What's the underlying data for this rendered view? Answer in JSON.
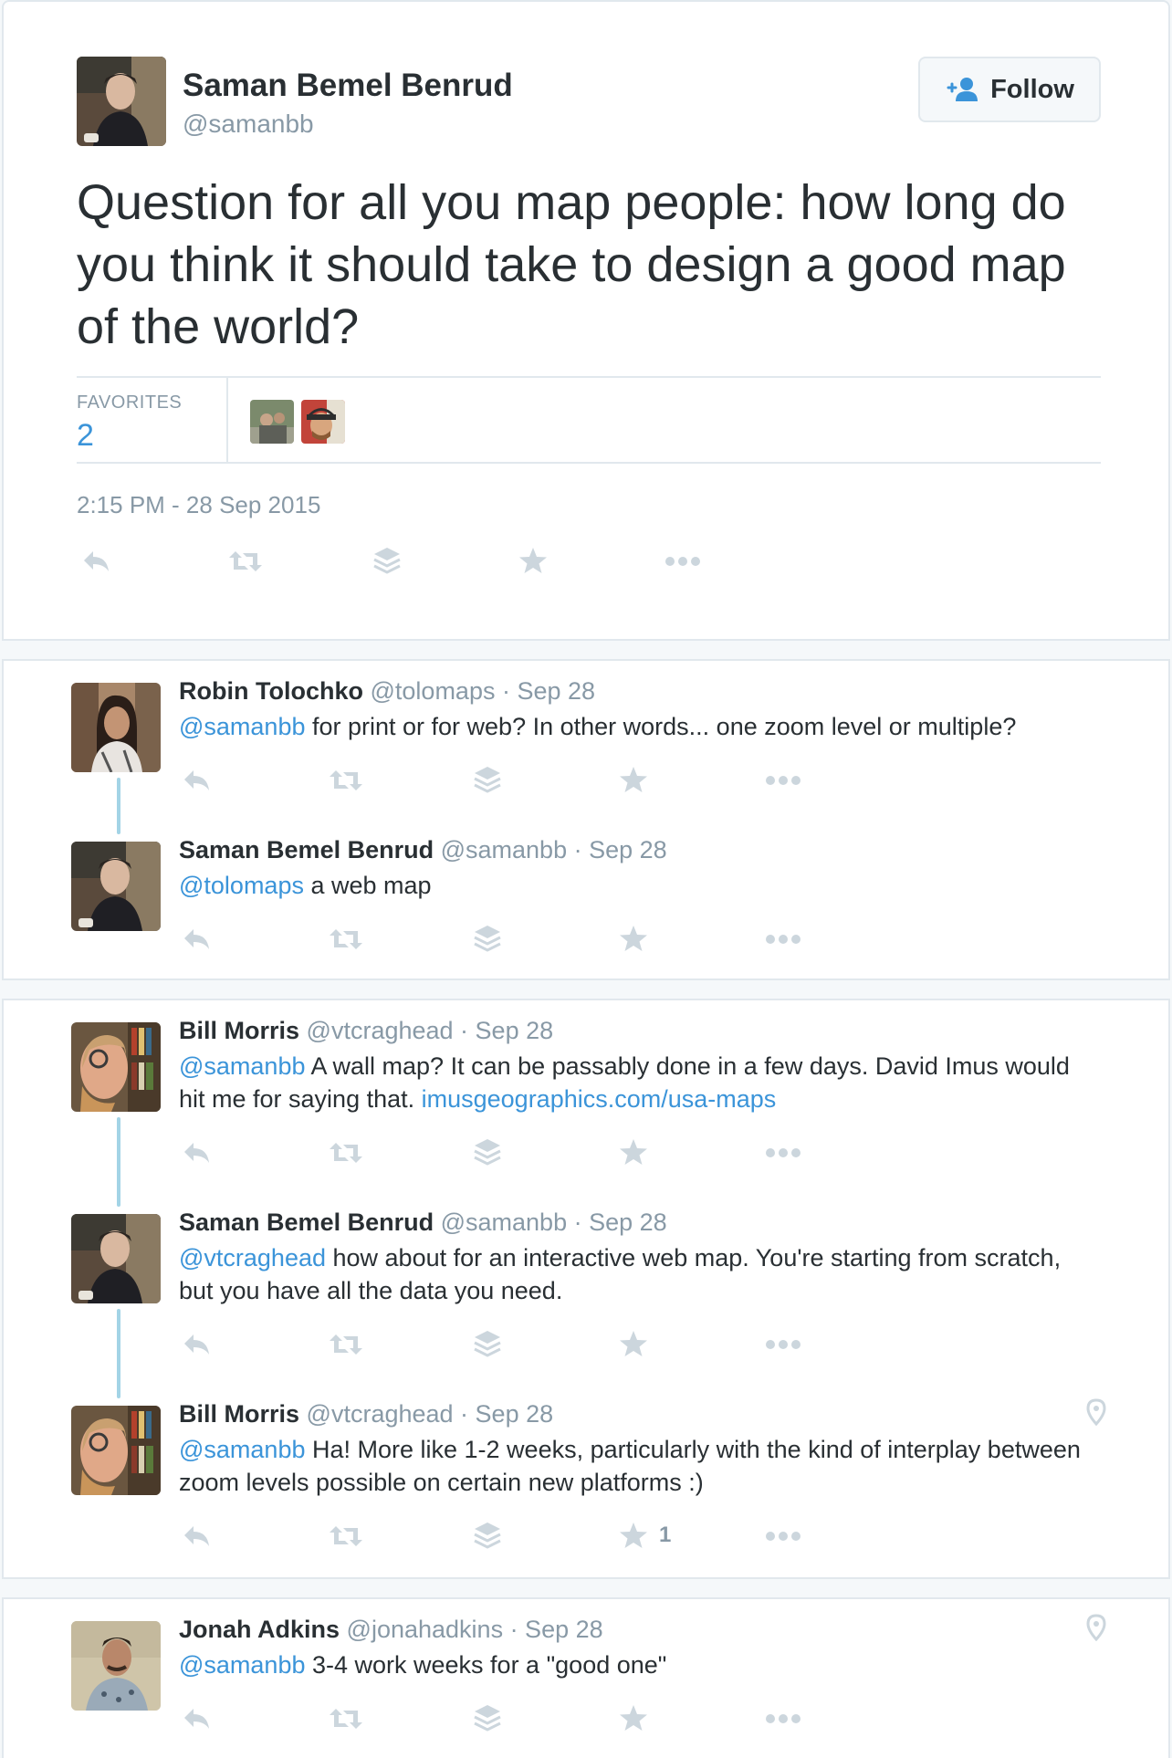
{
  "main_tweet": {
    "name": "Saman Bemel Benrud",
    "handle": "@samanbb",
    "follow_label": "Follow",
    "text": "Question for all you map people: how long do you think it should take to design a good map of the world?",
    "favorites_label": "FAVORITES",
    "favorites_count": "2",
    "timestamp": "2:15 PM - 28 Sep 2015"
  },
  "replies": [
    {
      "name": "Robin Tolochko",
      "meta": "@tolomaps · Sep 28",
      "mention": "@samanbb",
      "text": " for print or for web? In other words... one zoom level or multiple?"
    },
    {
      "name": "Saman Bemel Benrud",
      "meta": "@samanbb · Sep 28",
      "mention": "@tolomaps",
      "text": " a web map"
    },
    {
      "name": "Bill Morris",
      "meta": "@vtcraghead · Sep 28",
      "mention": "@samanbb",
      "text": " A wall map? It can be passably done in a few days. David Imus would hit me for saying that. ",
      "link": "imusgeographics.com/usa-maps"
    },
    {
      "name": "Saman Bemel Benrud",
      "meta": "@samanbb · Sep 28",
      "mention": "@vtcraghead",
      "text": " how about for an interactive web map. You're starting from scratch, but you have all the data you need."
    },
    {
      "name": "Bill Morris",
      "meta": "@vtcraghead · Sep 28",
      "mention": "@samanbb",
      "text": " Ha! More like 1-2 weeks, particularly with the kind of interplay between zoom levels possible on certain new platforms :)",
      "favorite_count": "1"
    },
    {
      "name": "Jonah Adkins",
      "meta": "@jonahadkins · Sep 28",
      "mention": "@samanbb",
      "text": " 3-4 work weeks for a \"good one\""
    }
  ],
  "colors": {
    "accent": "#3b94d9",
    "muted": "#8899a6",
    "icon": "#ccd6dd",
    "thread_line": "#a3d4e6"
  }
}
